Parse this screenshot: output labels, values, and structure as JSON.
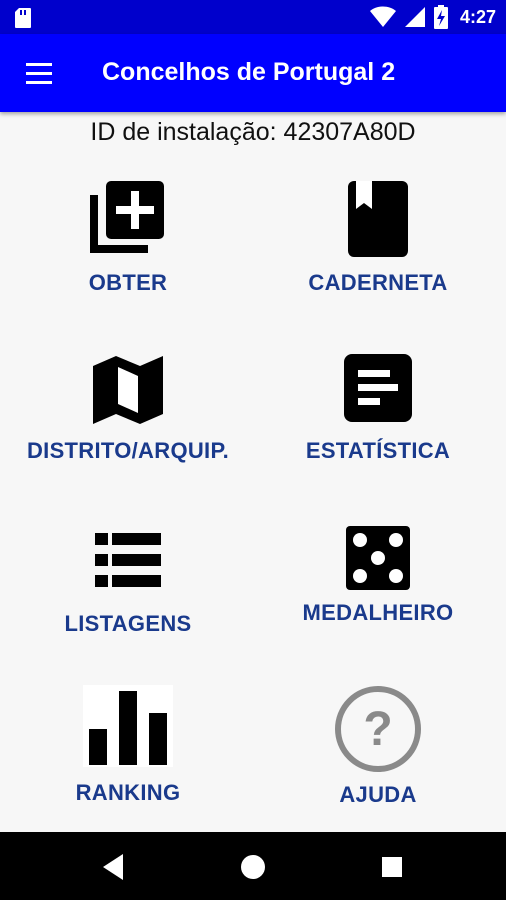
{
  "status_bar": {
    "time": "4:27",
    "icons": [
      "sd-card-icon",
      "wifi-icon",
      "signal-icon",
      "battery-charging-icon"
    ]
  },
  "app_bar": {
    "title": "Concelhos de Portugal 2",
    "menu_icon": "menu-icon"
  },
  "install_id": "ID de instalação: 42307A80D",
  "tiles": [
    {
      "label": "OBTER",
      "icon": "library-add-icon"
    },
    {
      "label": "CADERNETA",
      "icon": "book-icon"
    },
    {
      "label": "DISTRITO/ARQUIP.",
      "icon": "map-icon"
    },
    {
      "label": "ESTATÍSTICA",
      "icon": "stats-icon"
    },
    {
      "label": "LISTAGENS",
      "icon": "list-icon"
    },
    {
      "label": "MEDALHEIRO",
      "icon": "dice-icon"
    },
    {
      "label": "RANKING",
      "icon": "ranking-icon"
    },
    {
      "label": "AJUDA",
      "icon": "help-icon"
    }
  ],
  "nav_bar": {
    "buttons": [
      "back-icon",
      "home-icon",
      "recents-icon"
    ]
  },
  "colors": {
    "status_bar": "#0000cc",
    "app_bar": "#0000ff",
    "label": "#1a3a8c",
    "background": "#f7f7f7"
  }
}
